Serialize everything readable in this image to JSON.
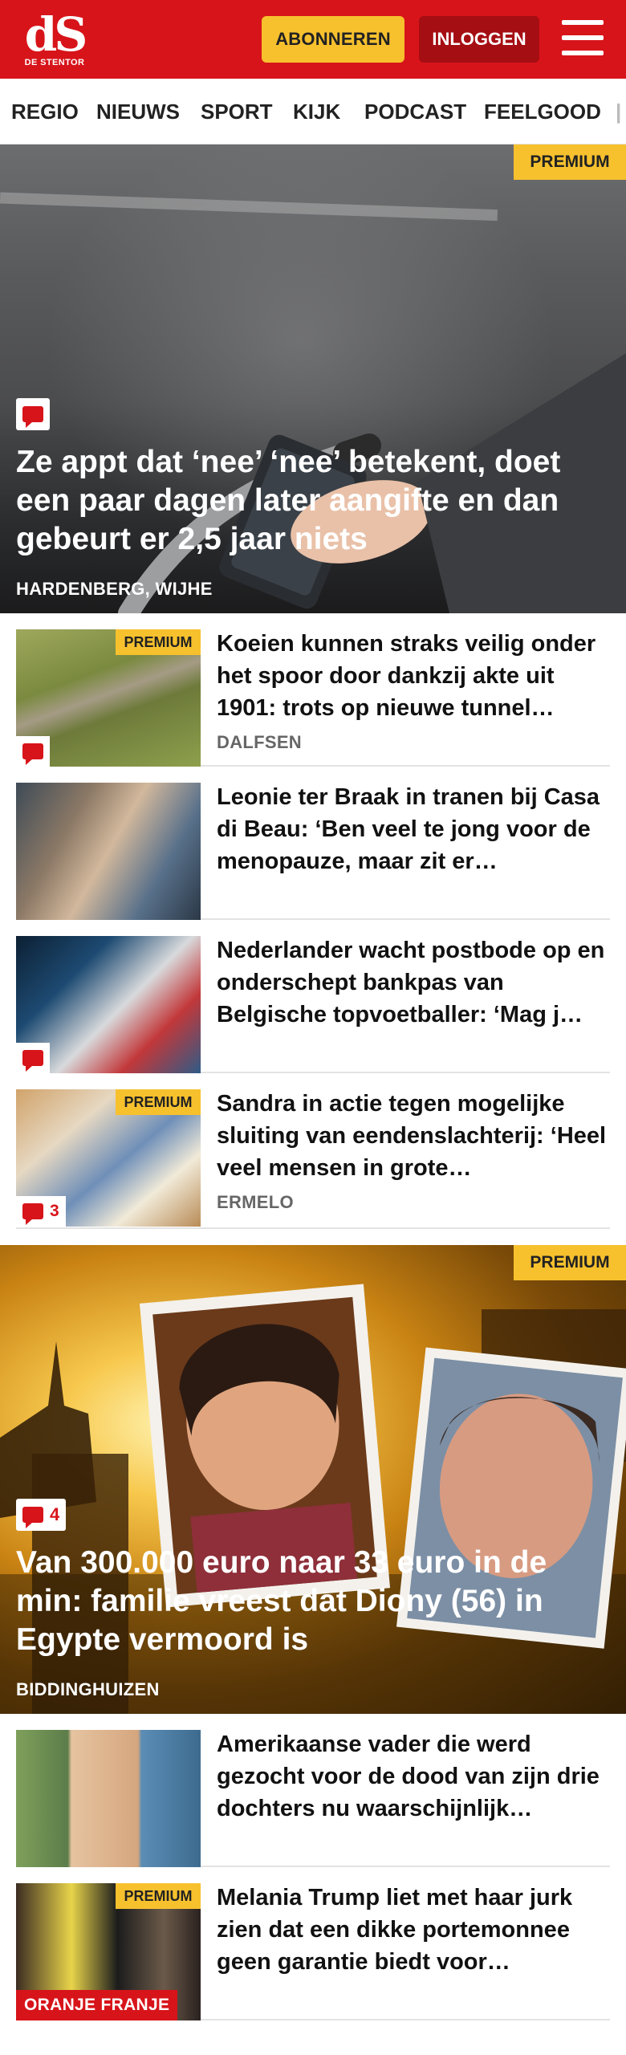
{
  "header": {
    "logo_mark": "dS",
    "logo_text": "DE STENTOR",
    "subscribe_label": "ABONNEREN",
    "login_label": "INLOGGEN",
    "menu_icon": "hamburger-menu-icon",
    "brand_color": "#d7141a",
    "accent_color": "#f7c12e"
  },
  "nav": {
    "items": [
      "REGIO",
      "NIEUWS",
      "SPORT",
      "KIJK",
      "PODCAST",
      "FEELGOOD"
    ]
  },
  "hero1": {
    "premium": "PREMIUM",
    "comment_icon": "comment-bubble-icon",
    "title": "Ze appt dat ‘nee’ ‘nee’ betekent, doet een paar dagen later aangifte en dan gebeurt er 2,5 jaar niets",
    "location": "HARDENBERG, WIJHE"
  },
  "articles": [
    {
      "premium": "PREMIUM",
      "comment_count": "",
      "title": "Koeien kunnen straks veilig onder het spoor door dankzij akte uit 1901: trots op nieuwe tunnel…",
      "location": "DALFSEN"
    },
    {
      "title": "Leonie ter Braak in tranen bij Casa di Beau: ‘Ben veel te jong voor de menopauze, maar zit er…"
    },
    {
      "comment_count": "",
      "title": "Nederlander wacht postbode op en onderschept bankpas van Belgische topvoetballer: ‘Mag j…"
    },
    {
      "premium": "PREMIUM",
      "comment_count": "3",
      "title": "Sandra in actie tegen mogelijke sluiting van eendenslachterij: ‘Heel veel mensen in grote…",
      "location": "ERMELO"
    }
  ],
  "hero2": {
    "premium": "PREMIUM",
    "comment_count": "4",
    "title": "Van 300.000 euro naar 33 euro in de min: familie vreest dat Diony (56) in Egypte vermoord is",
    "location": "BIDDINGHUIZEN"
  },
  "articles2": [
    {
      "title": "Amerikaanse vader die werd gezocht voor de dood van zijn drie dochters nu waarschijnlijk…"
    },
    {
      "premium": "PREMIUM",
      "label": "ORANJE FRANJE",
      "title": "Melania Trump liet met haar jurk zien dat een dikke portemonnee geen garantie biedt voor…"
    }
  ]
}
